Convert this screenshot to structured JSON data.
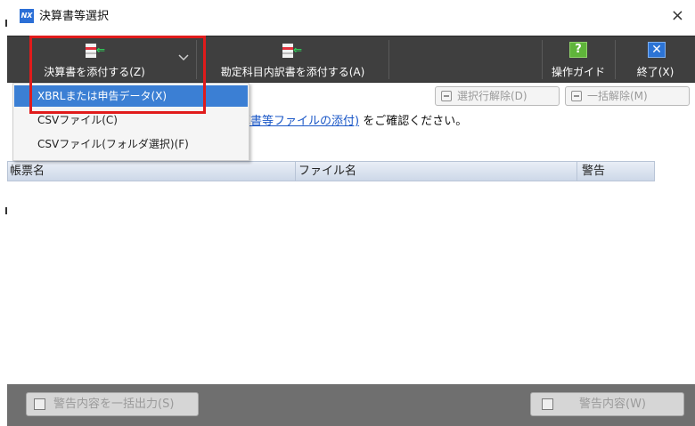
{
  "window": {
    "title": "決算書等選択",
    "app_logo": "NX",
    "close_glyph": "×"
  },
  "toolbar": {
    "attach_statement_label": "決算書を添付する(Z)",
    "attach_breakdown_label": "勘定科目内訳書を添付する(A)",
    "guide_label": "操作ガイド",
    "guide_glyph": "?",
    "exit_label": "終了(X)",
    "exit_glyph": "✕"
  },
  "dropdown": {
    "items": [
      {
        "label": "XBRLまたは申告データ(X)",
        "selected": true
      },
      {
        "label": "CSVファイル(C)",
        "selected": false
      },
      {
        "label": "CSVファイル(フォルダ選択)(F)",
        "selected": false
      }
    ]
  },
  "actions": {
    "deselect_row_label": "選択行解除(D)",
    "deselect_all_label": "一括解除(M)"
  },
  "notice": {
    "link_text": "算書等ファイルの添付)",
    "suffix_text": "をご確認ください。"
  },
  "table": {
    "columns": [
      "帳票名",
      "ファイル名",
      "警告"
    ],
    "rows": []
  },
  "bottom": {
    "export_warnings_label": "警告内容を一括出力(S)",
    "warning_detail_label": "警告内容(W)"
  },
  "colors": {
    "toolbar_bg": "#3f3f3f",
    "highlight": "#e01b1b",
    "menu_selected": "#3b7fd4",
    "link": "#1a57c7"
  }
}
